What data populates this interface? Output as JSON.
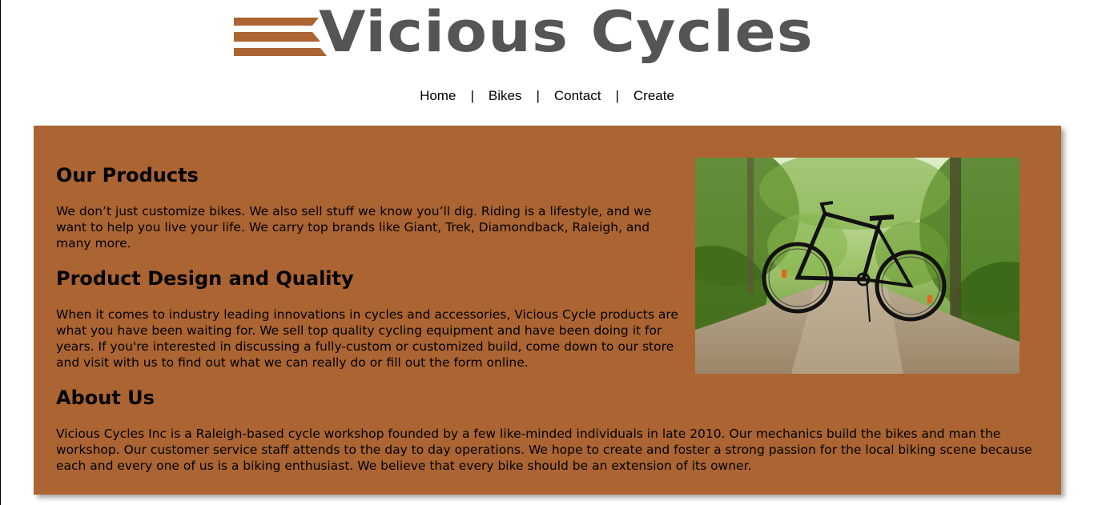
{
  "logo": {
    "text": "Vicious Cycles",
    "stripe_color": "#ab6432",
    "text_color": "#555555"
  },
  "nav": {
    "items": [
      {
        "label": "Home"
      },
      {
        "label": "Bikes"
      },
      {
        "label": "Contact"
      },
      {
        "label": "Create"
      }
    ],
    "separator": "|"
  },
  "content": {
    "background": "#ab6432",
    "products": {
      "heading": "Our Products",
      "body": "We don’t just customize bikes. We also sell stuff we know you’ll dig. Riding is a lifestyle, and we want to help you live your life. We carry top brands like Giant, Trek, Diamondback, Raleigh, and many more."
    },
    "design": {
      "heading": "Product Design and Quality",
      "body": "When it comes to industry leading innovations in cycles and accessories, Vicious Cycle products are what you have been waiting for. We sell top quality cycling equipment and have been doing it for years. If you're interested in discussing a fully-custom or customized build, come down to our store and visit with us to find out what we can really do or fill out the form online."
    },
    "about": {
      "heading": "About Us",
      "body": "Vicious Cycles Inc is a Raleigh-based cycle workshop founded by a few like-minded individuals in late 2010. Our mechanics build the bikes and man the workshop. Our customer service staff attends to the day to day operations. We hope to create and foster a strong passion for the local biking scene because each and every one of us is a biking enthusiast. We believe that every bike should be an extension of its owner."
    },
    "photo": {
      "icon": "bicycle-on-forest-path-photo"
    }
  }
}
